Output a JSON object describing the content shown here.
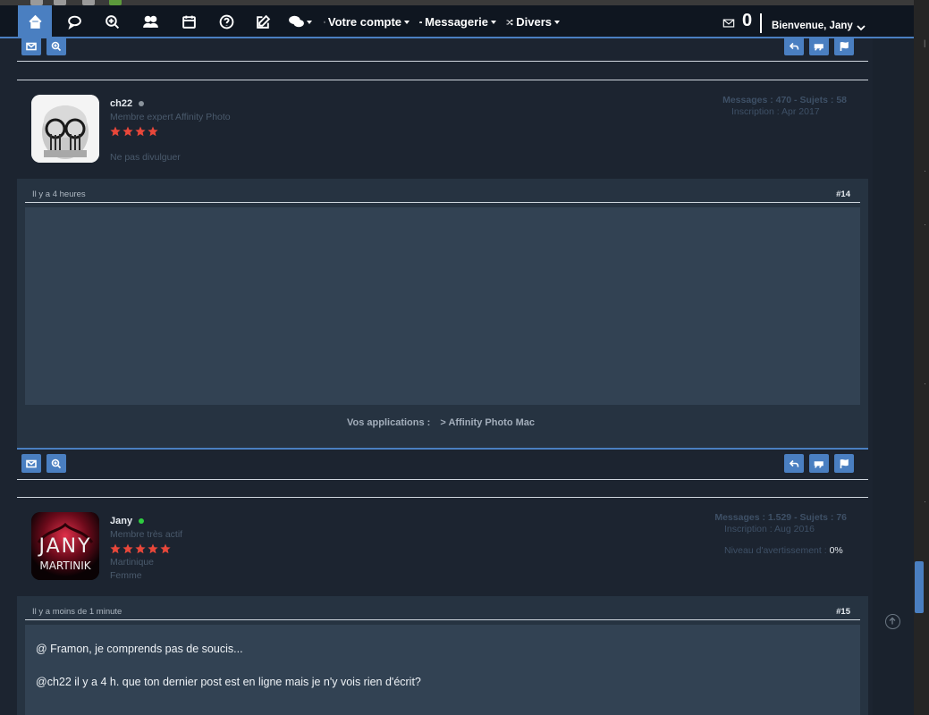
{
  "navbar": {
    "items": [
      {
        "name": "home-icon"
      },
      {
        "name": "chat-icon"
      },
      {
        "name": "search-zoom-icon"
      },
      {
        "name": "users-icon"
      },
      {
        "name": "calendar-icon"
      },
      {
        "name": "help-icon"
      },
      {
        "name": "edit-icon"
      },
      {
        "name": "comments-icon"
      }
    ],
    "account_label": "Votre compte",
    "messaging_label": "Messagerie",
    "misc_label": "Divers",
    "mail_count": "0",
    "welcome": "Bienvenue, Jany"
  },
  "posts": [
    {
      "username": "ch22",
      "rank": "Membre expert Affinity Photo",
      "stars": 4,
      "location": "Ne pas divulguer",
      "online": false,
      "stats": "Messages : 470 - Sujets : 58",
      "joined": "Inscription : Apr 2017",
      "time": "Il y a 4 heures",
      "number": "#14",
      "apps_label": "Vos applications :",
      "apps_value": "> Affinity Photo Mac"
    },
    {
      "username": "Jany",
      "rank": "Membre très actif",
      "stars": 5,
      "location": "Martinique",
      "gender": "Femme",
      "online": true,
      "stats": "Messages : 1.529 - Sujets : 76",
      "joined": "Inscription : Aug 2016",
      "warning_label": "Niveau d'avertissement :",
      "warning_value": "0%",
      "avatar_text_top": "JANY",
      "avatar_text_bottom": "MARTINIK",
      "time": "Il y a moins de 1 minute",
      "number": "#15",
      "message_lines": [
        "@ Framon, je comprends pas de soucis...",
        "@ch22 il y a 4 h. que ton dernier post est en ligne mais je n'y vois rien d'écrit?"
      ]
    }
  ],
  "colors": {
    "accent": "#4a7fc1",
    "star": "#e8473a",
    "online": "#2ecc40",
    "offline": "#8a939c"
  }
}
